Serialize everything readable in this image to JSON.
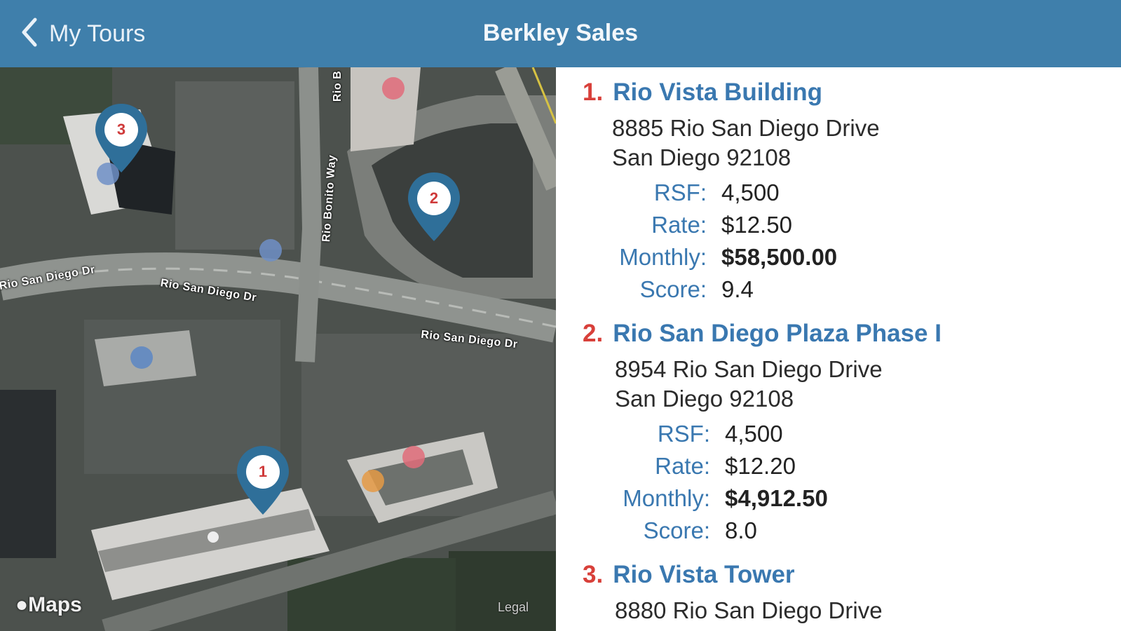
{
  "header": {
    "back_label": "My Tours",
    "title": "Berkley Sales"
  },
  "map": {
    "road_labels": [
      "Rio San Diego Dr",
      "Rio San Diego Dr",
      "Rio San Diego Dr",
      "Rio Bonito Way",
      "Rio B"
    ],
    "pins": [
      "1",
      "2",
      "3"
    ],
    "attribution": "Maps",
    "legal": "Legal"
  },
  "properties": [
    {
      "index": "1.",
      "name": "Rio Vista Building",
      "address_line1": "8885 Rio San Diego Drive",
      "address_line2": "San Diego 92108",
      "rsf_label": "RSF:",
      "rsf": "4,500",
      "rate_label": "Rate:",
      "rate": "$12.50",
      "monthly_label": "Monthly:",
      "monthly": "$58,500.00",
      "score_label": "Score:",
      "score": "9.4"
    },
    {
      "index": "2.",
      "name": "Rio San Diego Plaza Phase I",
      "address_line1": "8954 Rio San Diego Drive",
      "address_line2": "San Diego 92108",
      "rsf_label": "RSF:",
      "rsf": "4,500",
      "rate_label": "Rate:",
      "rate": "$12.20",
      "monthly_label": "Monthly:",
      "monthly": "$4,912.50",
      "score_label": "Score:",
      "score": "8.0"
    },
    {
      "index": "3.",
      "name": "Rio Vista Tower",
      "address_line1": "8880 Rio San Diego Drive"
    }
  ],
  "colors": {
    "header_bg": "#3f7fab",
    "link_blue": "#3a78b0",
    "index_red": "#d8403a",
    "pin_blue": "#2f6f99"
  }
}
